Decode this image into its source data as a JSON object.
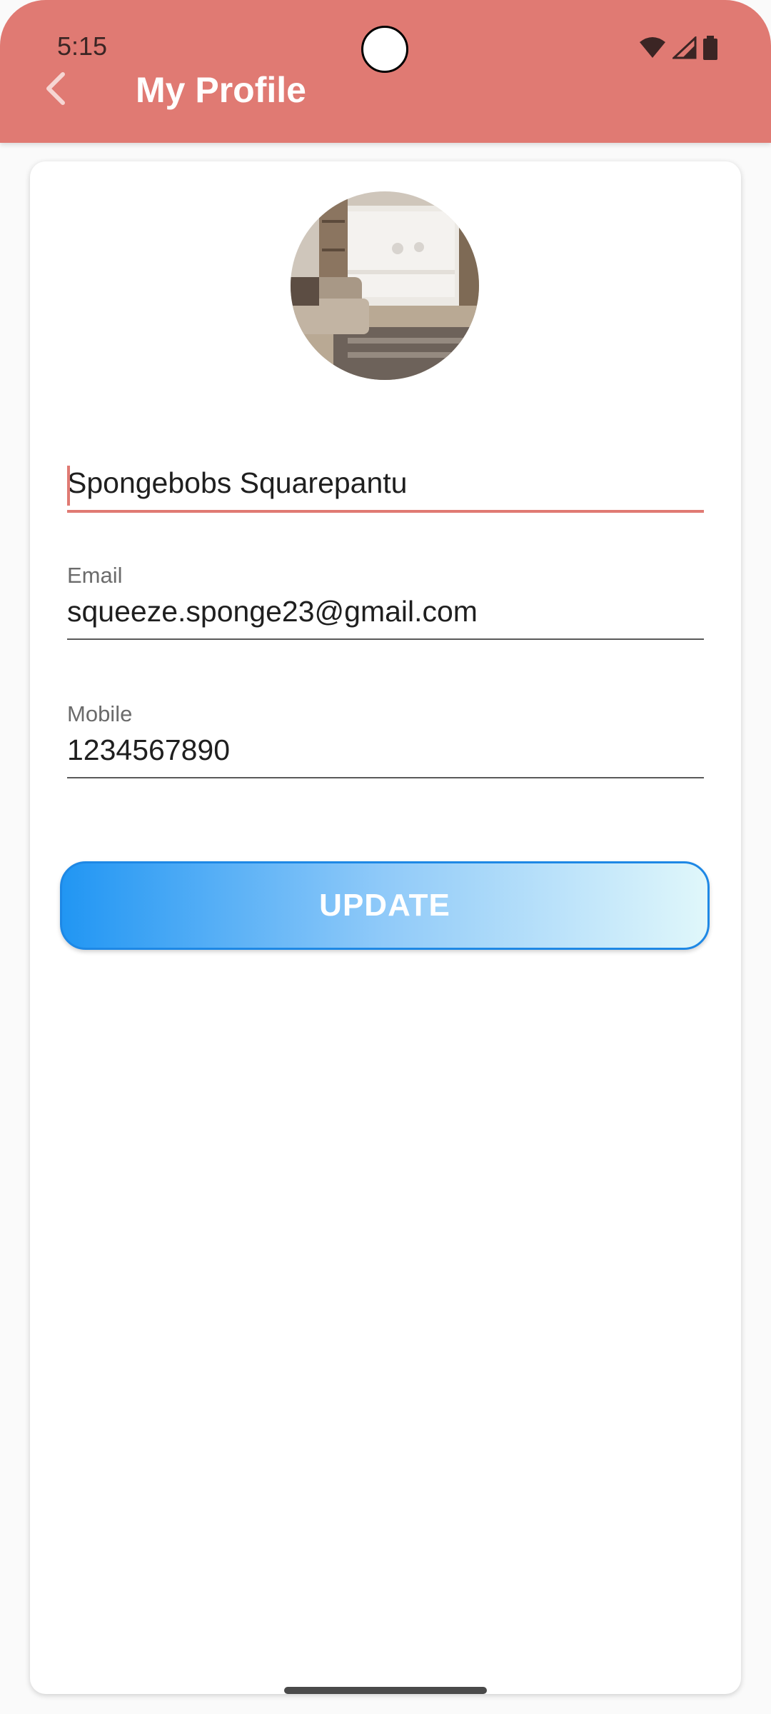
{
  "status_bar": {
    "time": "5:15",
    "icons": [
      "wifi-icon",
      "cellular-signal-icon",
      "battery-icon"
    ]
  },
  "app_bar": {
    "title": "My Profile",
    "back_icon": "chevron-left-icon",
    "background_color": "#e07a73"
  },
  "profile": {
    "avatar": "living-room-photo",
    "name_value": "Spongebobs Squarepantu",
    "email_label": "Email",
    "email_value": "squeeze.sponge23@gmail.com",
    "mobile_label": "Mobile",
    "mobile_value": "1234567890"
  },
  "actions": {
    "update_label": "UPDATE"
  },
  "colors": {
    "accent": "#e07a73",
    "button_gradient_start": "#2196f3",
    "button_gradient_end": "#e0f7fa"
  }
}
